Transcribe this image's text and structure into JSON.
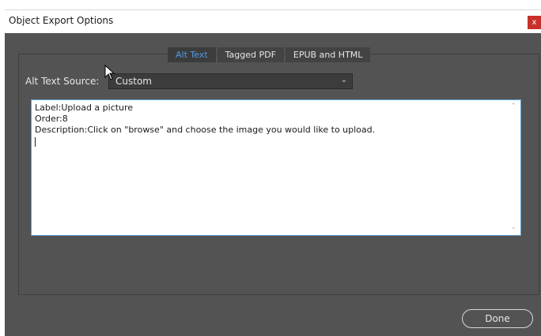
{
  "window": {
    "title": "Object Export Options",
    "close_label": "x"
  },
  "tabs": [
    {
      "label": "Alt Text",
      "active": true
    },
    {
      "label": "Tagged PDF",
      "active": false
    },
    {
      "label": "EPUB and HTML",
      "active": false
    }
  ],
  "alt_text_source": {
    "label": "Alt Text Source:",
    "value": "Custom"
  },
  "text_area": {
    "lines": [
      "Label:Upload a picture",
      "Order:8",
      "Description:Click on \"browse\" and choose the image you would like to upload."
    ]
  },
  "done_button": {
    "label": "Done"
  },
  "icons": {
    "close": "close-icon",
    "dropdown": "chevron-down-icon",
    "scroll_up": "chevron-up-icon",
    "scroll_down": "chevron-down-icon",
    "pointer": "mouse-pointer-icon"
  }
}
